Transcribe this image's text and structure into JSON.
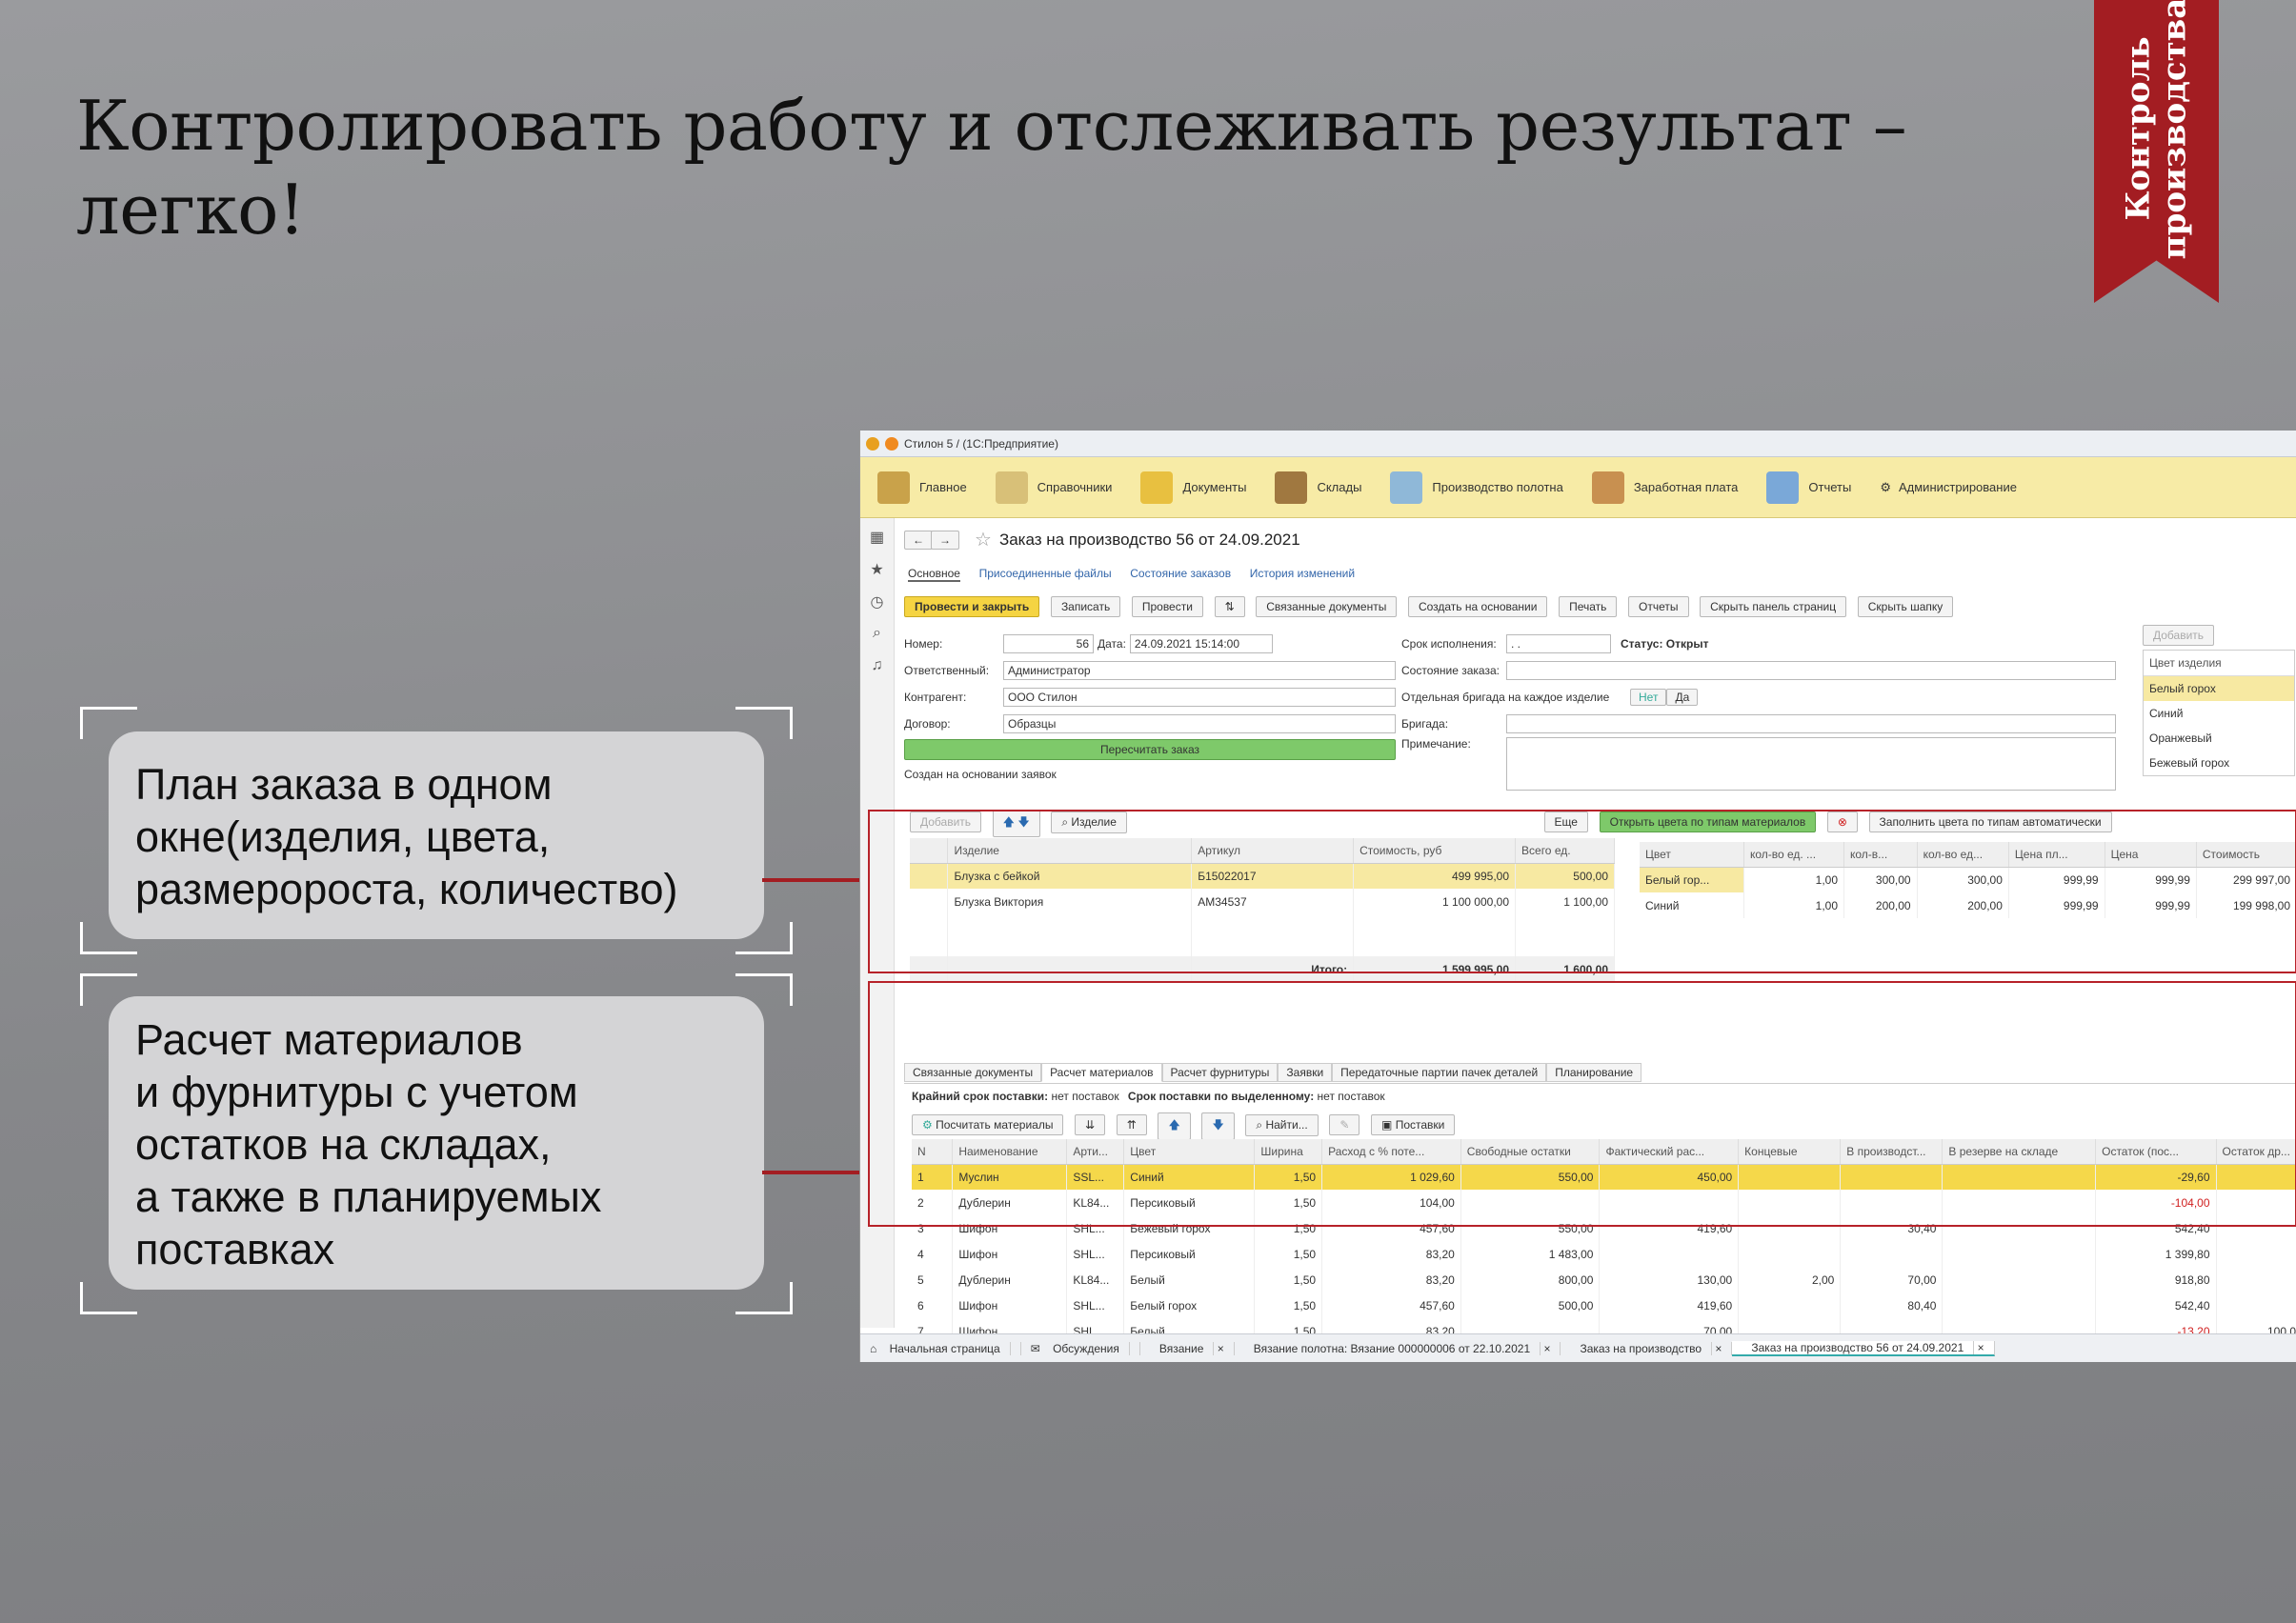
{
  "slide": {
    "title_line1": "Контролировать работу  и отслеживать результат  –",
    "title_line2": "легко!",
    "ribbon_line1": "Контроль",
    "ribbon_line2": "производства",
    "accent_color": "#a31d22"
  },
  "callouts": [
    {
      "lines": [
        "План заказа в одном",
        "окне(изделия, цвета,",
        "размеророста, количество)"
      ]
    },
    {
      "lines": [
        "Расчет материалов",
        "и фурнитуры с учетом",
        "остатков на складах,",
        "а также в планируемых",
        "поставках"
      ]
    }
  ],
  "app": {
    "window_title": "Стилон 5 /  (1С:Предприятие)",
    "menu": [
      "Главное",
      "Справочники",
      "Документы",
      "Склады",
      "Производство полотна",
      "Заработная плата",
      "Отчеты",
      "Администрирование"
    ],
    "doc_title": "Заказ на производство 56 от 24.09.2021",
    "doc_tabs": [
      "Основное",
      "Присоединенные файлы",
      "Состояние заказов",
      "История изменений"
    ],
    "toolbar": [
      "Провести и закрыть",
      "Записать",
      "Провести",
      "Связанные документы",
      "Создать на основании",
      "Печать",
      "Отчеты",
      "Скрыть панель страниц",
      "Скрыть шапку"
    ],
    "form": {
      "number_label": "Номер:",
      "number_value": "56",
      "date_label": "Дата:",
      "date_value": "24.09.2021 15:14:00",
      "resp_label": "Ответственный:",
      "resp_value": "Администратор",
      "contr_label": "Контрагент:",
      "contr_value": "ООО Стилон",
      "dogovor_label": "Договор:",
      "dogovor_value": "Образцы",
      "recalc": "Пересчитать заказ",
      "created": "Создан на основании заявок",
      "srok_label": "Срок исполнения:",
      "srok_value": ". .",
      "status": "Статус: Открыт",
      "state_label": "Состояние заказа:",
      "brigade_each_label": "Отдельная бригада на каждое изделие",
      "net": "Нет",
      "da": "Да",
      "brigade_label": "Бригада:",
      "note_label": "Примечание:"
    },
    "right_panel": {
      "add": "Добавить",
      "header": "Цвет изделия",
      "items": [
        "Белый горох",
        "Синий",
        "Оранжевый",
        "Бежевый горох"
      ]
    },
    "products": {
      "add": "Добавить",
      "izdelie_btn": "Изделие",
      "more": "Еще",
      "columns": [
        "Изделие",
        "Артикул",
        "Стоимость, руб",
        "Всего ед."
      ],
      "rows": [
        [
          "Блузка с бейкой",
          "Б15022017",
          "499 995,00",
          "500,00"
        ],
        [
          "Блузка Виктория",
          "АМ34537",
          "1 100 000,00",
          "1 100,00"
        ]
      ],
      "total_label": "Итого:",
      "total_cost": "1 599 995,00",
      "total_qty": "1 600,00"
    },
    "colors": {
      "open_btn": "Открыть цвета по типам материалов",
      "fill_btn": "Заполнить цвета по типам автоматически",
      "columns": [
        "Цвет",
        "кол-во ед. ...",
        "кол-в...",
        "кол-во ед...",
        "Цена пл...",
        "Цена",
        "Стоимость"
      ],
      "rows": [
        [
          "Белый гор...",
          "1,00",
          "300,00",
          "300,00",
          "999,99",
          "999,99",
          "299 997,00"
        ],
        [
          "Синий",
          "1,00",
          "200,00",
          "200,00",
          "999,99",
          "999,99",
          "199 998,00"
        ]
      ]
    },
    "bottom_tabs": [
      "Связанные документы",
      "Расчет материалов",
      "Расчет фурнитуры",
      "Заявки",
      "Передаточные партии пачек деталей",
      "Планирование"
    ],
    "deadline_label": "Крайний срок поставки:",
    "deadline_value": "нет поставок",
    "deadline2_label": "Срок поставки по выделенному:",
    "deadline2_value": "нет поставок",
    "mat_toolbar": [
      "Посчитать материалы",
      "Найти...",
      "Поставки"
    ],
    "materials": {
      "columns": [
        "N",
        "Наименование",
        "Арти...",
        "Цвет",
        "Ширина",
        "Расход с % поте...",
        "Свободные остатки",
        "Фактический рас...",
        "Концевые",
        "В производст...",
        "В резерве на складе",
        "Остаток (пос...",
        "Остаток др..."
      ],
      "rows": [
        [
          "1",
          "Муслин",
          "SSL...",
          "Синий",
          "1,50",
          "1 029,60",
          "550,00",
          "450,00",
          "",
          "",
          "",
          "-29,60",
          ""
        ],
        [
          "2",
          "Дублерин",
          "KL84...",
          "Персиковый",
          "1,50",
          "104,00",
          "",
          "",
          "",
          "",
          "",
          "-104,00",
          ""
        ],
        [
          "3",
          "Шифон",
          "SHL...",
          "Бежевый горох",
          "1,50",
          "457,60",
          "550,00",
          "419,60",
          "",
          "30,40",
          "",
          "542,40",
          ""
        ],
        [
          "4",
          "Шифон",
          "SHL...",
          "Персиковый",
          "1,50",
          "83,20",
          "1 483,00",
          "",
          "",
          "",
          "",
          "1 399,80",
          ""
        ],
        [
          "5",
          "Дублерин",
          "KL84...",
          "Белый",
          "1,50",
          "83,20",
          "800,00",
          "130,00",
          "2,00",
          "70,00",
          "",
          "918,80",
          ""
        ],
        [
          "6",
          "Шифон",
          "SHL...",
          "Белый горох",
          "1,50",
          "457,60",
          "500,00",
          "419,60",
          "",
          "80,40",
          "",
          "542,40",
          ""
        ],
        [
          "7",
          "Шифон",
          "SHL...",
          "Белый",
          "1,50",
          "83,20",
          "",
          "70,00",
          "",
          "",
          "",
          "-13,20",
          "100,0"
        ]
      ]
    },
    "taskbar": [
      "Начальная страница",
      "Обсуждения",
      "Вязание",
      "Вязание полотна: Вязание 000000006 от 22.10.2021",
      "Заказ на производство",
      "Заказ на производство 56 от 24.09.2021"
    ]
  }
}
